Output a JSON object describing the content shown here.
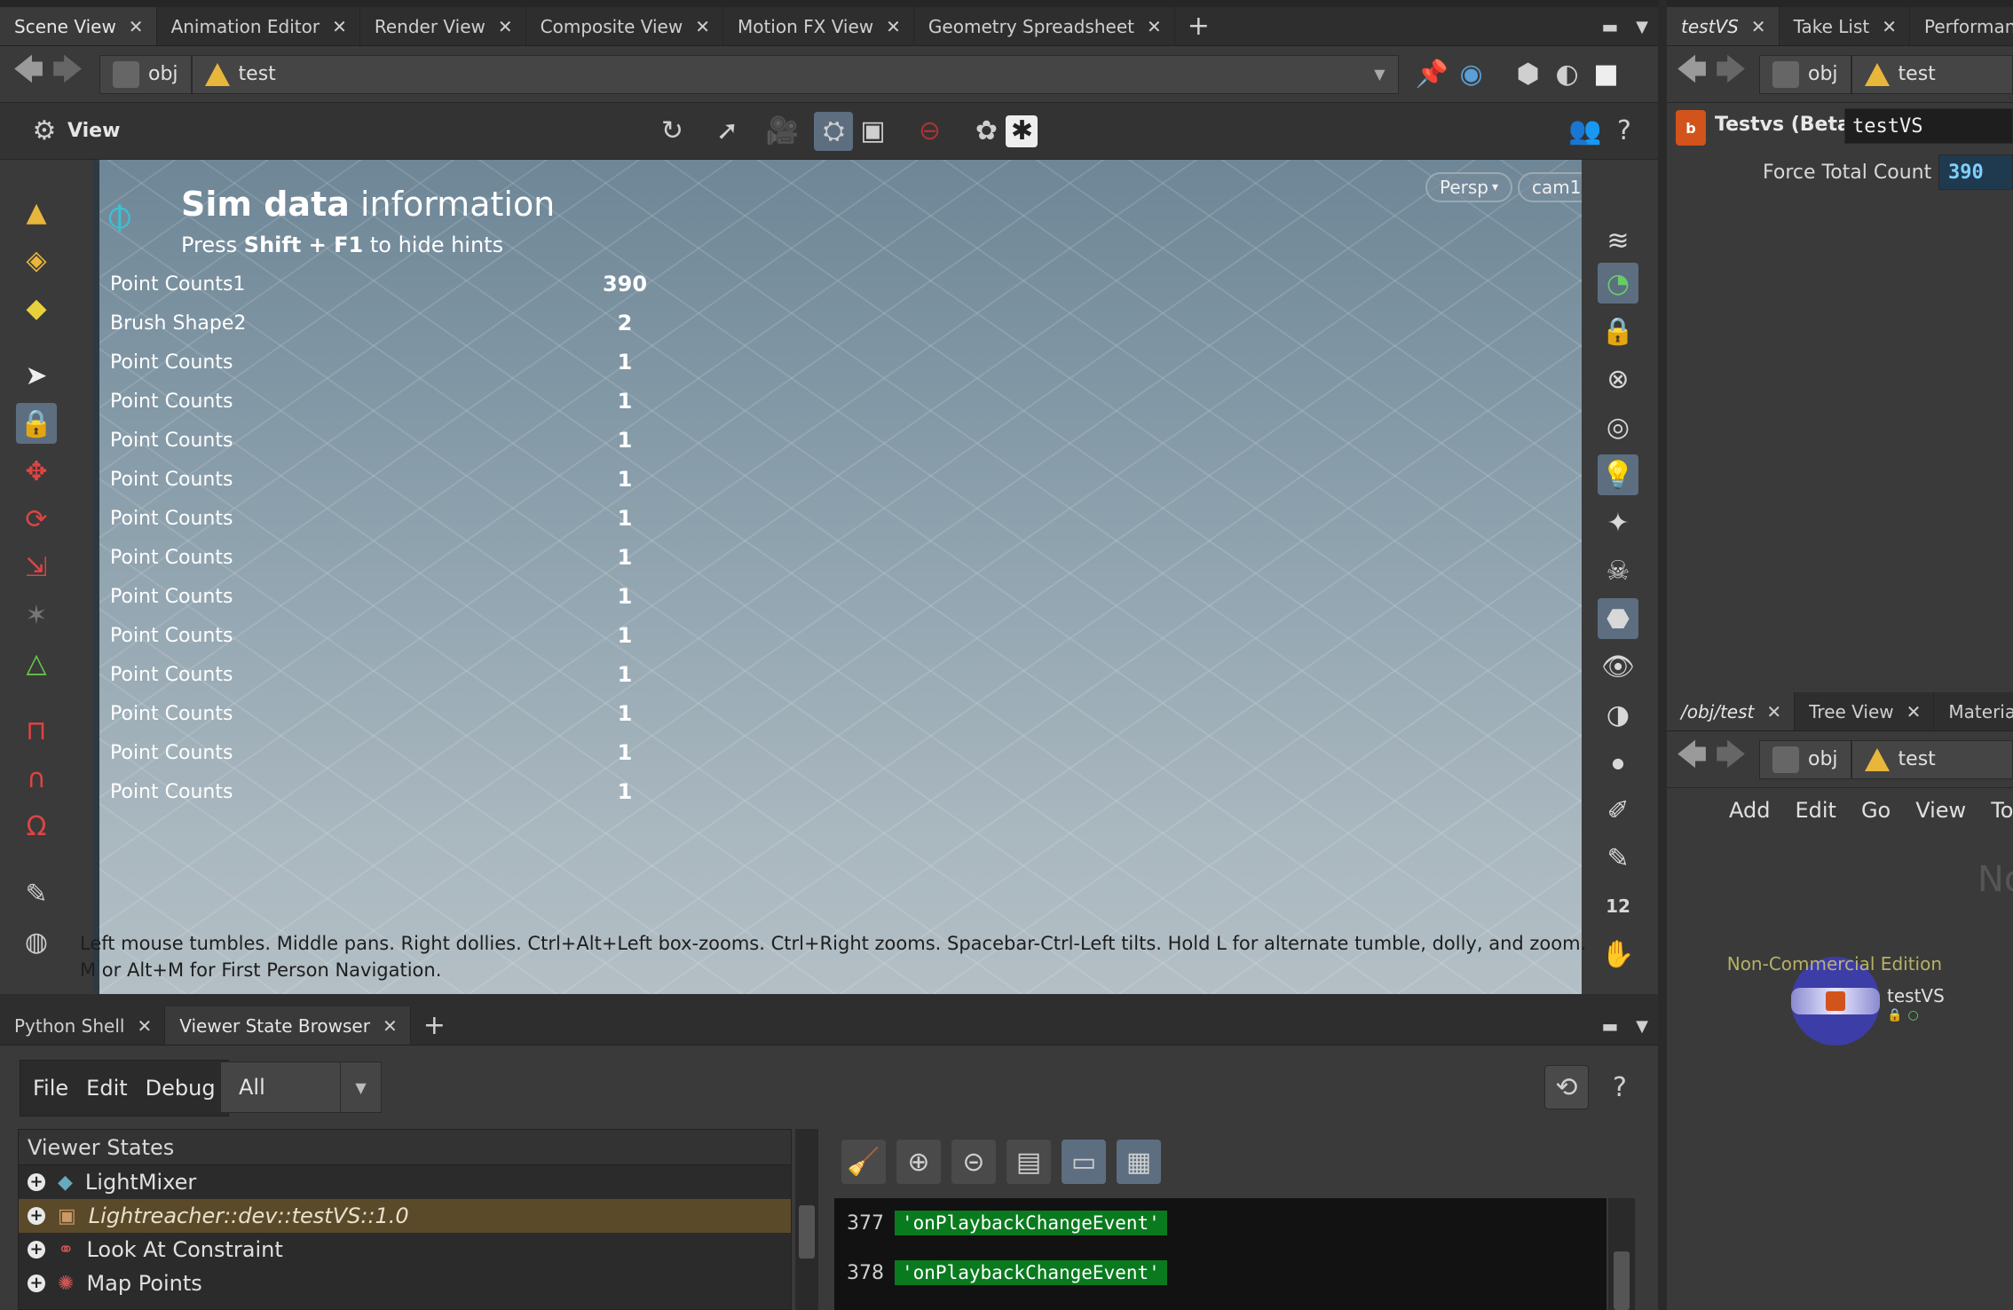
{
  "main_tabs": [
    {
      "label": "Scene View",
      "active": true
    },
    {
      "label": "Animation Editor"
    },
    {
      "label": "Render View"
    },
    {
      "label": "Composite View"
    },
    {
      "label": "Motion FX View"
    },
    {
      "label": "Geometry Spreadsheet"
    }
  ],
  "path": {
    "root": "obj",
    "node": "test"
  },
  "view_label": "View",
  "viewport": {
    "title_bold": "Sim data",
    "title_rest": " information",
    "hint_pre": "Press ",
    "hint_key": "Shift + F1",
    "hint_post": " to hide hints",
    "camera_mode": "Persp",
    "camera_name": "cam1",
    "rows": [
      {
        "label": "Point Counts1",
        "value": "390"
      },
      {
        "label": "Brush Shape2",
        "value": "2"
      },
      {
        "label": "Point Counts",
        "value": "1"
      },
      {
        "label": "Point Counts",
        "value": "1"
      },
      {
        "label": "Point Counts",
        "value": "1"
      },
      {
        "label": "Point Counts",
        "value": "1"
      },
      {
        "label": "Point Counts",
        "value": "1"
      },
      {
        "label": "Point Counts",
        "value": "1"
      },
      {
        "label": "Point Counts",
        "value": "1"
      },
      {
        "label": "Point Counts",
        "value": "1"
      },
      {
        "label": "Point Counts",
        "value": "1"
      },
      {
        "label": "Point Counts",
        "value": "1"
      },
      {
        "label": "Point Counts",
        "value": "1"
      },
      {
        "label": "Point Counts",
        "value": "1"
      }
    ],
    "help_line": "Left mouse tumbles. Middle pans. Right dollies. Ctrl+Alt+Left box-zooms. Ctrl+Right zooms. Spacebar-Ctrl-Left tilts. Hold L for alternate tumble, dolly, and zoom.    M or Alt+M for First Person Navigation.",
    "edition": "Non-Commercial Edition"
  },
  "bottom_tabs": [
    {
      "label": "Python Shell"
    },
    {
      "label": "Viewer State Browser",
      "active": true
    }
  ],
  "browser": {
    "menu": [
      "File",
      "Edit",
      "Debug"
    ],
    "filter": "All",
    "list_header": "Viewer States",
    "states": [
      {
        "label": "LightMixer"
      },
      {
        "label": "Lightreacher::dev::testVS::1.0",
        "selected": true
      },
      {
        "label": "Look At Constraint"
      },
      {
        "label": "Map Points"
      }
    ],
    "console": [
      {
        "num": "377",
        "text": "'onPlaybackChangeEvent'"
      },
      {
        "num": "378",
        "text": "'onPlaybackChangeEvent'"
      }
    ]
  },
  "right_top_tabs": [
    {
      "label": "testVS",
      "active": true
    },
    {
      "label": "Take List"
    },
    {
      "label": "Performan"
    }
  ],
  "params": {
    "node_type": "Testvs (Beta)",
    "node_name": "testVS",
    "field_label": "Force Total Count",
    "field_value": "390"
  },
  "right_bottom_tabs": [
    {
      "label": "/obj/test",
      "active": true
    },
    {
      "label": "Tree View"
    },
    {
      "label": "Materia"
    }
  ],
  "network": {
    "menu": [
      "Add",
      "Edit",
      "Go",
      "View",
      "To"
    ],
    "truncated_text": "No",
    "node_label": "testVS"
  },
  "colors": {
    "accent_blue": "#5d6e80",
    "selected_row": "#5a4a2a",
    "console_string": "#0a7a1e",
    "param_field": "#1f3a4f"
  }
}
